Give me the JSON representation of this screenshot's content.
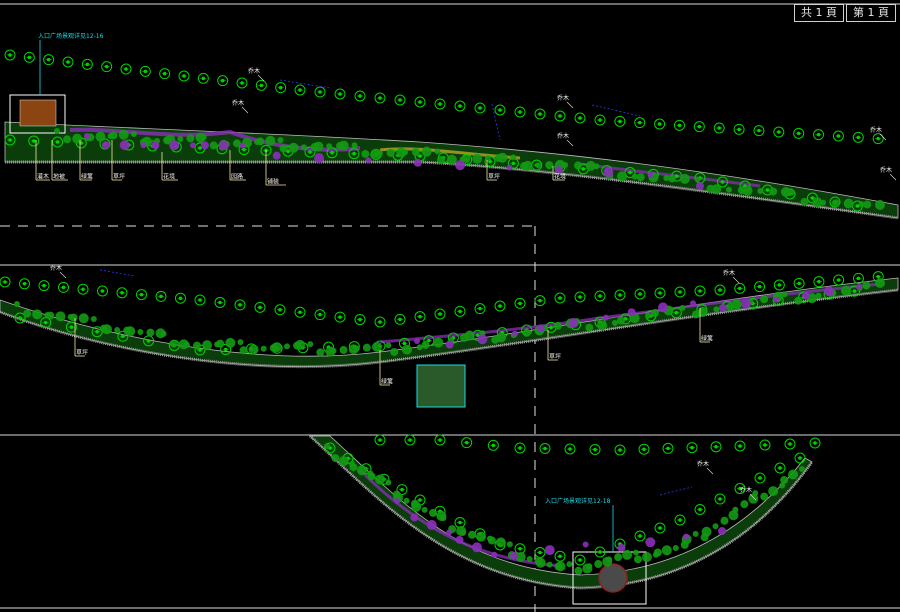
{
  "header": {
    "total_pages": "共 1 頁",
    "page_no": "第 1 頁"
  },
  "labels": {
    "tree": "乔木",
    "entrance_top": "入口广场景观详见12-16",
    "entrance_bottom": "入口广场景观详见12-18",
    "shrub": "灌木",
    "groundcover": "地被",
    "hedge": "绿篱",
    "flower": "花境",
    "lawn": "草坪",
    "path": "园路",
    "pavement": "铺装"
  },
  "colors": {
    "bg": "#000000",
    "frame": "#d9d9d9",
    "tree": "#00d400",
    "shrub_dark": "#0a7a0a",
    "flower_purple": "#8a2fb8",
    "flower_yellow": "#b7a52a",
    "brown": "#8b4513",
    "cyan": "#19d8e8",
    "blue": "#2a3aff",
    "leader": "#f5e6a0"
  }
}
